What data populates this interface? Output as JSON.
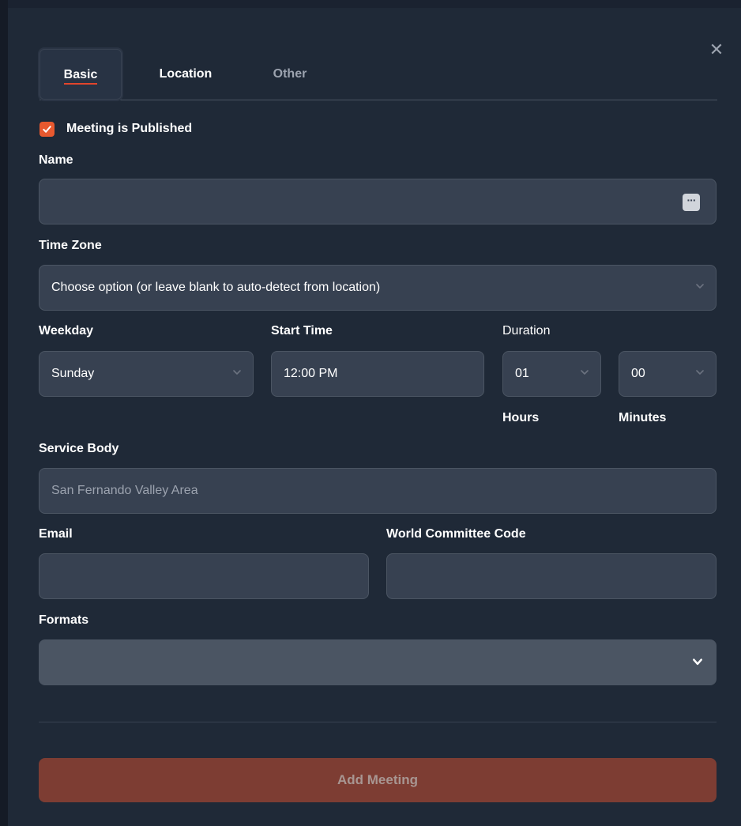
{
  "tabs": [
    {
      "label": "Basic",
      "active": true
    },
    {
      "label": "Location",
      "active": false
    },
    {
      "label": "Other",
      "active": false
    }
  ],
  "close_icon": "close-icon",
  "published": {
    "label": "Meeting is Published",
    "checked": true
  },
  "name": {
    "label": "Name",
    "value": ""
  },
  "time_zone": {
    "label": "Time Zone",
    "value": "Choose option (or leave blank to auto-detect from location)"
  },
  "weekday": {
    "label": "Weekday",
    "value": "Sunday"
  },
  "start_time": {
    "label": "Start Time",
    "value": "12:00 PM"
  },
  "duration": {
    "label": "Duration",
    "hours": {
      "value": "01",
      "label": "Hours"
    },
    "minutes": {
      "value": "00",
      "label": "Minutes"
    }
  },
  "service_body": {
    "label": "Service Body",
    "value": "San Fernando Valley Area"
  },
  "email": {
    "label": "Email",
    "value": ""
  },
  "world_committee_code": {
    "label": "World Committee Code",
    "value": ""
  },
  "formats": {
    "label": "Formats",
    "value": ""
  },
  "add_button": {
    "label": "Add Meeting"
  },
  "colors": {
    "accent": "#e8592f",
    "tab_underline": "#e2452b",
    "button_bg": "#7d3d33",
    "modal_bg": "#1f2937",
    "field_bg": "#374151"
  }
}
